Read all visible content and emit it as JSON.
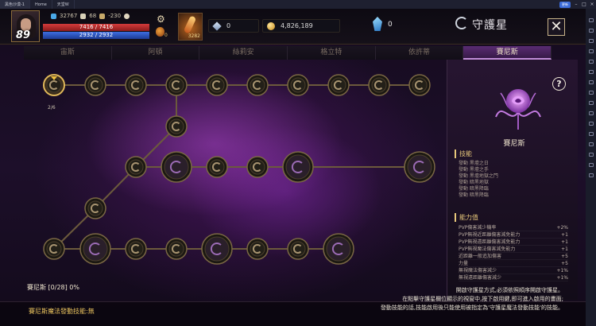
{
  "emulator": {
    "tabs": [
      "黑色沙漠-1",
      "Home",
      "天堂W"
    ],
    "badge": "更新"
  },
  "hud": {
    "level": "89",
    "stat1": "32767",
    "stat2": "68",
    "stat3": "-230",
    "hp": "7416 / 7416",
    "mp": "2932 / 2932",
    "potion_count": "0",
    "item_count": "3282",
    "diamond": "0",
    "gold": "4,826,189",
    "crystal": "0"
  },
  "header": {
    "title": "守護星",
    "close": "✕"
  },
  "tabs": [
    {
      "label": "宙斯",
      "active": false
    },
    {
      "label": "阿頓",
      "active": false
    },
    {
      "label": "絲莉安",
      "active": false
    },
    {
      "label": "格立特",
      "active": false
    },
    {
      "label": "依許蒂",
      "active": false
    },
    {
      "label": "賽尼斯",
      "active": true
    }
  ],
  "tree": {
    "node_progress": "2/6",
    "total_progress": "賽尼斯 [0/28] 0%"
  },
  "panel": {
    "help": "?",
    "guardian_name": "賽尼斯",
    "skills_title": "技能",
    "skills": [
      "發動 黑壇之日",
      "發動 黑壇之手",
      "發動 黑壇地獄之門",
      "發動 暗黑地獄",
      "發動 暗黑降臨",
      "發動 暗黑降臨"
    ],
    "abilities_title": "能力值",
    "abilities": [
      {
        "name": "PVP傷害減少機率",
        "value": "+2%"
      },
      {
        "name": "PVP無視近距離傷害減免能力",
        "value": "+1"
      },
      {
        "name": "PVP無視遠距離傷害減免能力",
        "value": "+1"
      },
      {
        "name": "PVP無視魔法傷害減免能力",
        "value": "+1"
      },
      {
        "name": "近距離一般追加傷害",
        "value": "+5"
      },
      {
        "name": "力量",
        "value": "+5"
      },
      {
        "name": "無視魔法傷害減少",
        "value": "+1%"
      },
      {
        "name": "無視遠距離傷害減少",
        "value": "+1%"
      }
    ]
  },
  "footer": {
    "magic_skill": "賽尼斯魔法發動技能:無",
    "desc_lines": [
      "開啟守護星方式,必須依照順序開啟守護星。",
      "在點擊守護星欄位顯示的視窗中,按下啟用鍵,即可進入啟用的畫面;",
      "發動技能的話,技能啟用後只能使用被指定為'守護星魔法發動技能'的技能。"
    ]
  },
  "colors": {
    "accent_gold": "#e6c77a",
    "active_tab": "#5a2c73",
    "hp_bar": "#d33b3b",
    "mp_bar": "#3e6ee0"
  }
}
